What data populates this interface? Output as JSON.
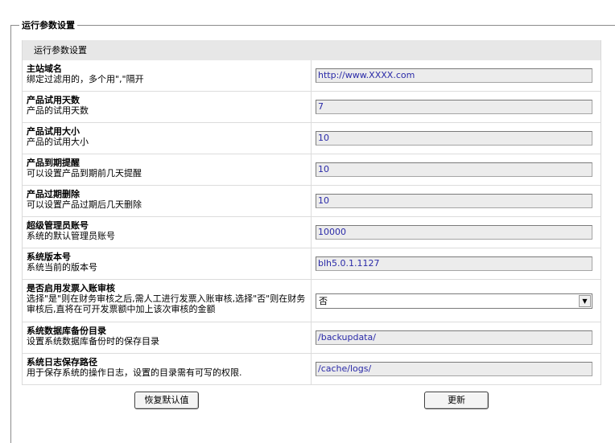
{
  "fieldset": {
    "legend": "运行参数设置"
  },
  "panel": {
    "header": "运行参数设置",
    "rows": [
      {
        "title": "主站域名",
        "desc": "绑定过滤用的，多个用\",\"隔开",
        "value": "http://www.XXXX.com"
      },
      {
        "title": "产品试用天数",
        "desc": "产品的试用天数",
        "value": "7"
      },
      {
        "title": "产品试用大小",
        "desc": "产品的试用大小",
        "value": "10"
      },
      {
        "title": "产品到期提醒",
        "desc": "可以设置产品到期前几天提醒",
        "value": "10"
      },
      {
        "title": "产品过期删除",
        "desc": "可以设置产品过期后几天删除",
        "value": "10"
      },
      {
        "title": "超级管理员账号",
        "desc": "系统的默认管理员账号",
        "value": "10000"
      },
      {
        "title": "系统版本号",
        "desc": "系统当前的版本号",
        "value": "blh5.0.1.1127"
      },
      {
        "title": "是否启用发票入账审核",
        "desc": "选择\"是\"则在财务审核之后,需人工进行发票入账审核,选择\"否\"则在财务审核后,直将在可开发票额中加上该次审核的金额",
        "value": "否",
        "type": "select"
      },
      {
        "title": "系统数据库备份目录",
        "desc": "设置系统数据库备份时的保存目录",
        "value": "/backupdata/"
      },
      {
        "title": "系统日志保存路径",
        "desc": "用于保存系统的操作日志，设置的目录需有可写的权限.",
        "value": "/cache/logs/"
      }
    ]
  },
  "buttons": {
    "restore": "恢复默认值",
    "update": "更新"
  },
  "icons": {
    "dropdown": "chevron-down-icon"
  }
}
